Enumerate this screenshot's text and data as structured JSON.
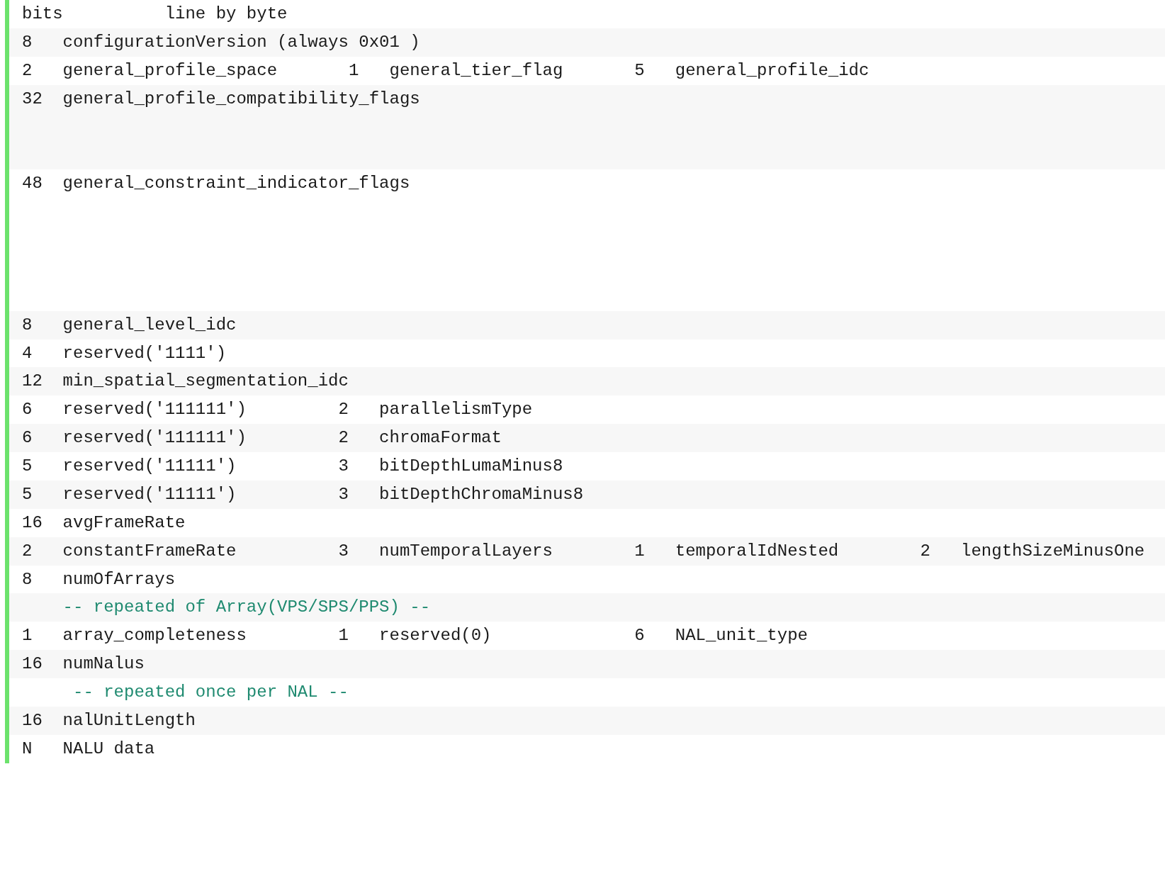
{
  "code_block": {
    "lines": [
      {
        "kind": "header",
        "text": "bits          line by byte"
      },
      {
        "kind": "code",
        "text": "8   configurationVersion (always 0x01 )"
      },
      {
        "kind": "code",
        "text": "2   general_profile_space       1   general_tier_flag       5   general_profile_idc"
      },
      {
        "kind": "code",
        "text": "32  general_profile_compatibility_flags\n\n\n"
      },
      {
        "kind": "code",
        "text": "48  general_constraint_indicator_flags\n\n\n\n\n"
      },
      {
        "kind": "code",
        "text": "8   general_level_idc"
      },
      {
        "kind": "code",
        "text": "4   reserved('1111')"
      },
      {
        "kind": "code",
        "text": "12  min_spatial_segmentation_idc"
      },
      {
        "kind": "code",
        "text": "6   reserved('111111')         2   parallelismType"
      },
      {
        "kind": "code",
        "text": "6   reserved('111111')         2   chromaFormat"
      },
      {
        "kind": "code",
        "text": "5   reserved('11111')          3   bitDepthLumaMinus8"
      },
      {
        "kind": "code",
        "text": "5   reserved('11111')          3   bitDepthChromaMinus8"
      },
      {
        "kind": "code",
        "text": "16  avgFrameRate\n"
      },
      {
        "kind": "code",
        "text": "2   constantFrameRate          3   numTemporalLayers        1   temporalIdNested        2   lengthSizeMinusOne"
      },
      {
        "kind": "code",
        "text": "8   numOfArrays"
      },
      {
        "kind": "comment",
        "text": "    -- repeated of Array(VPS/SPS/PPS) --"
      },
      {
        "kind": "code",
        "text": "1   array_completeness         1   reserved(0)              6   NAL_unit_type"
      },
      {
        "kind": "code",
        "text": "16  numNalus\n"
      },
      {
        "kind": "comment",
        "text": "     -- repeated once per NAL --"
      },
      {
        "kind": "code",
        "text": "16  nalUnitLength"
      },
      {
        "kind": "code",
        "text": "N   NALU data"
      }
    ]
  }
}
